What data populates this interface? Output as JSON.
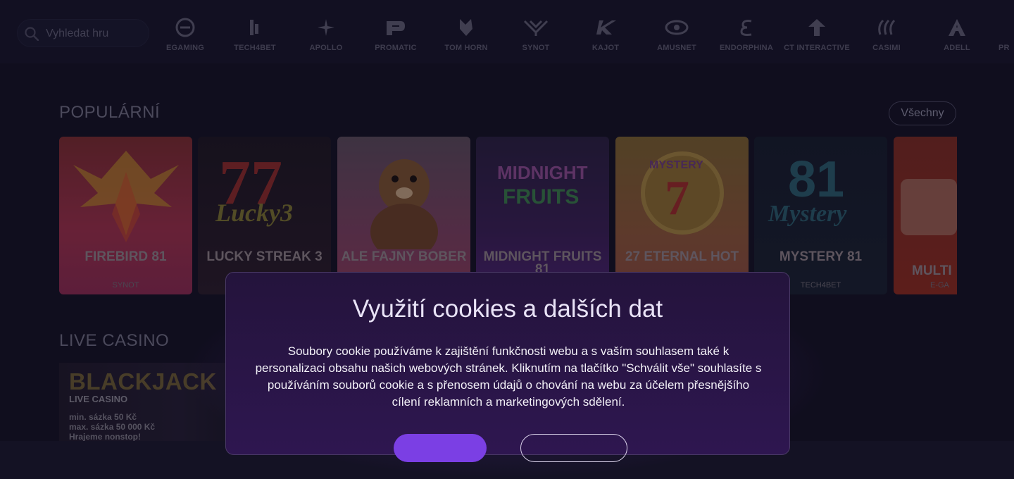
{
  "search": {
    "placeholder": "Vyhledat hru"
  },
  "providers": [
    {
      "name": "EGAMING",
      "icon": "egaming-logo-icon"
    },
    {
      "name": "TECH4BET",
      "icon": "tech4bet-logo-icon"
    },
    {
      "name": "APOLLO",
      "icon": "apollo-logo-icon"
    },
    {
      "name": "PROMATIC",
      "icon": "promatic-logo-icon"
    },
    {
      "name": "TOM HORN",
      "icon": "tom-horn-logo-icon"
    },
    {
      "name": "SYNOT",
      "icon": "synot-logo-icon"
    },
    {
      "name": "KAJOT",
      "icon": "kajot-logo-icon"
    },
    {
      "name": "AMUSNET",
      "icon": "amusnet-logo-icon"
    },
    {
      "name": "ENDORPHINA",
      "icon": "endorphina-logo-icon"
    },
    {
      "name": "CT INTERACTIVE",
      "icon": "ct-interactive-logo-icon"
    },
    {
      "name": "CASIMI",
      "icon": "casimi-logo-icon"
    },
    {
      "name": "ADELL",
      "icon": "adell-logo-icon"
    },
    {
      "name": "PR",
      "icon": "provider-logo-icon"
    }
  ],
  "popular": {
    "title": "POPULÁRNÍ",
    "all_label": "Všechny",
    "games": [
      {
        "title": "FIREBIRD 81",
        "provider": "SYNOT",
        "color": "#8a2a3a"
      },
      {
        "title": "LUCKY STREAK 3",
        "provider": "",
        "color": "#2a1a26"
      },
      {
        "title": "ALE FAJNY BOBER",
        "provider": "",
        "color": "#6a3a4a"
      },
      {
        "title": "MIDNIGHT FRUITS 81",
        "provider": "",
        "color": "#3a2050"
      },
      {
        "title": "27 ETERNAL HOT",
        "provider": "",
        "color": "#7a5a30"
      },
      {
        "title": "MYSTERY 81",
        "provider": "TECH4BET",
        "color": "#1c2438"
      },
      {
        "title": "MULTI",
        "provider": "E-GA",
        "color": "#7a2420"
      }
    ]
  },
  "live_casino": {
    "title": "LIVE CASINO",
    "card": {
      "title": "BLACKJACK",
      "subtitle": "LIVE CASINO",
      "min": "min. sázka 50 Kč",
      "max": "max. sázka 50 000 Kč",
      "cta": "Hrajeme nonstop!"
    }
  },
  "cookie_modal": {
    "title": "Využití cookies a dalších dat",
    "text": "Soubory cookie používáme k zajištění funkčnosti webu a s vaším souhlasem také k personalizaci obsahu našich webových stránek. Kliknutím na tlačítko \"Schválit vše\" souhlasíte s používáním souborů cookie a s přenosem údajů o chování na webu za účelem přesnějšího cílení reklamních a marketingových sdělení."
  }
}
